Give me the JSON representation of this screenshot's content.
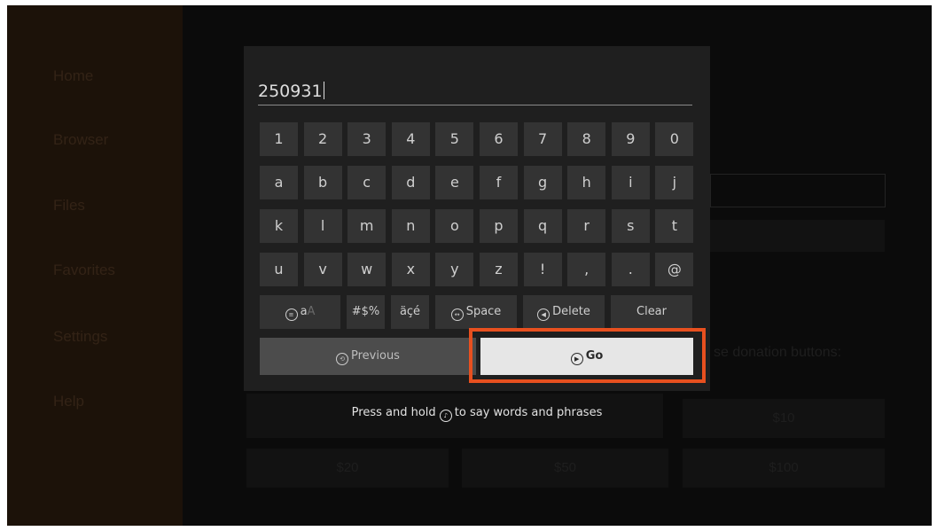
{
  "sidebar": {
    "items": [
      {
        "label": "Home"
      },
      {
        "label": "Browser"
      },
      {
        "label": "Files"
      },
      {
        "label": "Favorites"
      },
      {
        "label": "Settings"
      },
      {
        "label": "Help"
      }
    ]
  },
  "background": {
    "donation_text": "se donation buttons:",
    "amounts": [
      "$10",
      "$20",
      "$50",
      "$100"
    ]
  },
  "keyboard": {
    "input_value": "250931",
    "rows": [
      [
        "1",
        "2",
        "3",
        "4",
        "5",
        "6",
        "7",
        "8",
        "9",
        "0"
      ],
      [
        "a",
        "b",
        "c",
        "d",
        "e",
        "f",
        "g",
        "h",
        "i",
        "j"
      ],
      [
        "k",
        "l",
        "m",
        "n",
        "o",
        "p",
        "q",
        "r",
        "s",
        "t"
      ],
      [
        "u",
        "v",
        "w",
        "x",
        "y",
        "z",
        "!",
        ",",
        ".",
        "@"
      ]
    ],
    "case_key": {
      "main": "a",
      "alt": "A"
    },
    "symbols_key": "#$%",
    "accents_key": "äçé",
    "space_key": "Space",
    "delete_key": "Delete",
    "clear_key": "Clear",
    "previous_label": "Previous",
    "go_label": "Go"
  },
  "voice_hint": {
    "before": "Press and hold",
    "after": "to say words and phrases"
  },
  "colors": {
    "highlight": "#e8501f",
    "go_button": "#e6e6e6",
    "key": "#333333",
    "panel": "#1f1f1f"
  }
}
